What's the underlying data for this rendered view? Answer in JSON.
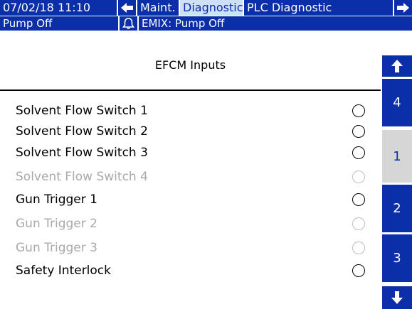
{
  "header": {
    "datetime": "07/02/18 11:10",
    "back_icon": "left-arrow-icon",
    "tabs": [
      {
        "label": "Maint."
      },
      {
        "label": "Diagnostic"
      },
      {
        "label": "PLC Diagnostic"
      }
    ],
    "forward_icon": "right-arrow-icon"
  },
  "status": {
    "pump_state": "Pump Off",
    "alarm_icon": "bell-icon",
    "message": "EMIX: Pump Off"
  },
  "panel": {
    "title": "EFCM Inputs",
    "rows": [
      {
        "label": "Solvent Flow Switch 1",
        "enabled": true
      },
      {
        "label": "Solvent Flow Switch 2",
        "enabled": true
      },
      {
        "label": "Solvent Flow Switch 3",
        "enabled": true
      },
      {
        "label": "Solvent Flow Switch 4",
        "enabled": false
      },
      {
        "label": "Gun Trigger 1",
        "enabled": true
      },
      {
        "label": "Gun Trigger 2",
        "enabled": false
      },
      {
        "label": "Gun Trigger 3",
        "enabled": false
      },
      {
        "label": "Safety Interlock",
        "enabled": true
      }
    ]
  },
  "side_nav": {
    "up_icon": "up-arrow-icon",
    "pages": [
      "4",
      "1",
      "2",
      "3"
    ],
    "active_page": "1",
    "down_icon": "down-arrow-icon"
  },
  "colors": {
    "accent": "#0a2fa8",
    "active_tab": "#cfe0f5",
    "disabled_text": "#a9a9a9"
  }
}
